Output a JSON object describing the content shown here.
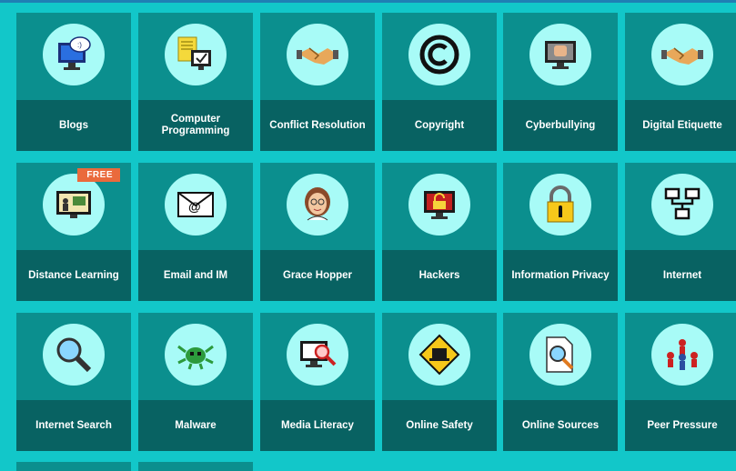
{
  "topics": [
    {
      "label": "Blogs",
      "icon": "blog-monitor-icon"
    },
    {
      "label": "Computer Programming",
      "icon": "code-monitor-icon"
    },
    {
      "label": "Conflict Resolution",
      "icon": "handshake-icon"
    },
    {
      "label": "Copyright",
      "icon": "copyright-icon"
    },
    {
      "label": "Cyberbullying",
      "icon": "fist-monitor-icon"
    },
    {
      "label": "Digital Etiquette",
      "icon": "handshake-icon"
    },
    {
      "label": "Distance Learning",
      "icon": "teacher-screen-icon",
      "badge": "FREE"
    },
    {
      "label": "Email and IM",
      "icon": "email-envelope-icon"
    },
    {
      "label": "Grace Hopper",
      "icon": "portrait-icon"
    },
    {
      "label": "Hackers",
      "icon": "unlocked-monitor-icon"
    },
    {
      "label": "Information Privacy",
      "icon": "padlock-icon"
    },
    {
      "label": "Internet",
      "icon": "network-icon"
    },
    {
      "label": "Internet Search",
      "icon": "magnifier-icon"
    },
    {
      "label": "Malware",
      "icon": "bug-icon"
    },
    {
      "label": "Media Literacy",
      "icon": "media-magnifier-icon"
    },
    {
      "label": "Online Safety",
      "icon": "warning-laptop-icon"
    },
    {
      "label": "Online Sources",
      "icon": "document-search-icon"
    },
    {
      "label": "Peer Pressure",
      "icon": "people-group-icon"
    }
  ]
}
